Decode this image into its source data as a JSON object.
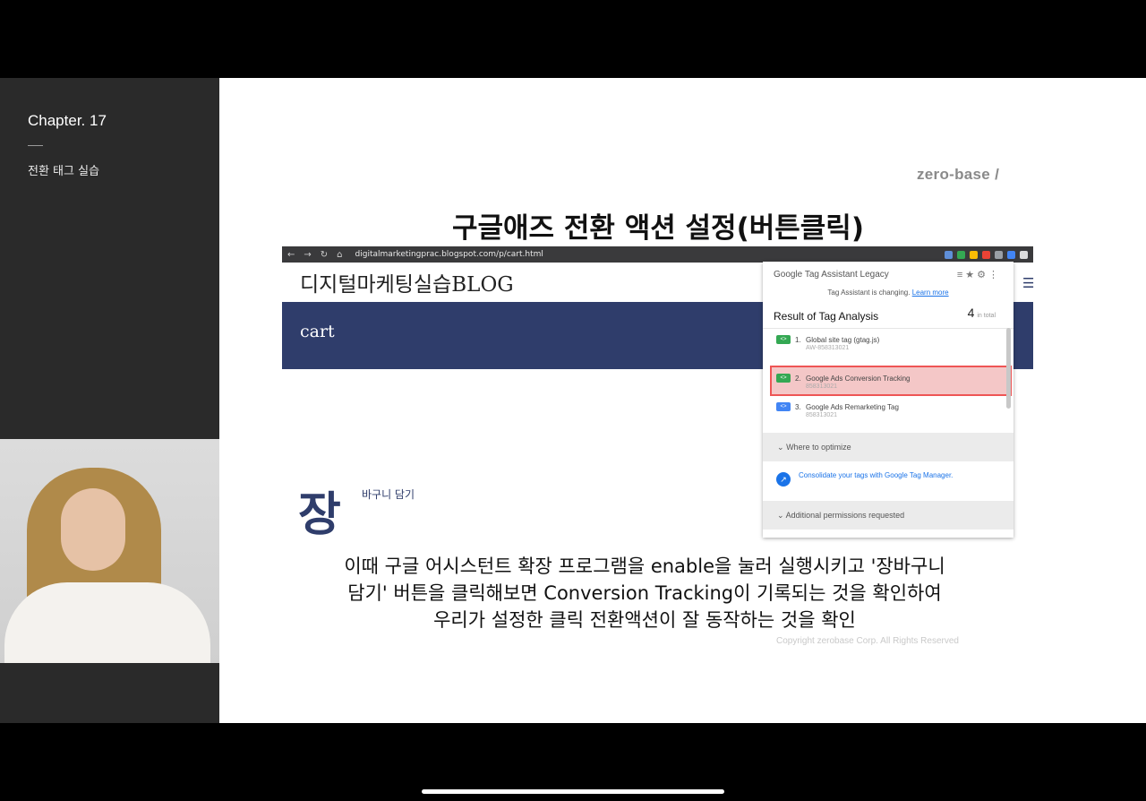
{
  "sidebar": {
    "chapter": "Chapter. 17",
    "subtitle": "전환 태그 실습"
  },
  "slide": {
    "logo": "zero-base /",
    "title": "구글애즈 전환 액션 설정(버튼클릭)",
    "caption_lines": [
      "이때 구글 어시스턴트 확장 프로그램을 enable을 눌러 실행시키고 '장바구니",
      "담기' 버튼을 클릭해보면 Conversion Tracking이 기록되는 것을 확인하여",
      "우리가 설정한 클릭 전환액션이 잘 동작하는 것을 확인"
    ],
    "copyright": "Copyright zerobase Corp. All Rights Reserved"
  },
  "browser": {
    "url": "digitalmarketingprac.blogspot.com/p/cart.html",
    "blog_title": "디지털마케팅실습BLOG",
    "nav_label": "cart",
    "big_char": "장",
    "small_label": "바구니 담기"
  },
  "tag_assistant": {
    "brand": "Google Tag Assistant Legacy",
    "note": "Tag Assistant is changing.",
    "learn_more": "Learn more",
    "result_title": "Result of Tag Analysis",
    "count": "4",
    "count_suffix": "in total",
    "items": [
      {
        "num": "1.",
        "name": "Global site tag (gtag.js)",
        "id": "AW-858313021"
      },
      {
        "num": "2.",
        "name": "Google Ads Conversion Tracking",
        "id": "858313021"
      },
      {
        "num": "3.",
        "name": "Google Ads Remarketing Tag",
        "id": "858313021"
      }
    ],
    "where_to_optimize": "Where to optimize",
    "consolidate": "Consolidate your tags with Google Tag Manager.",
    "additional": "Additional permissions requested"
  }
}
